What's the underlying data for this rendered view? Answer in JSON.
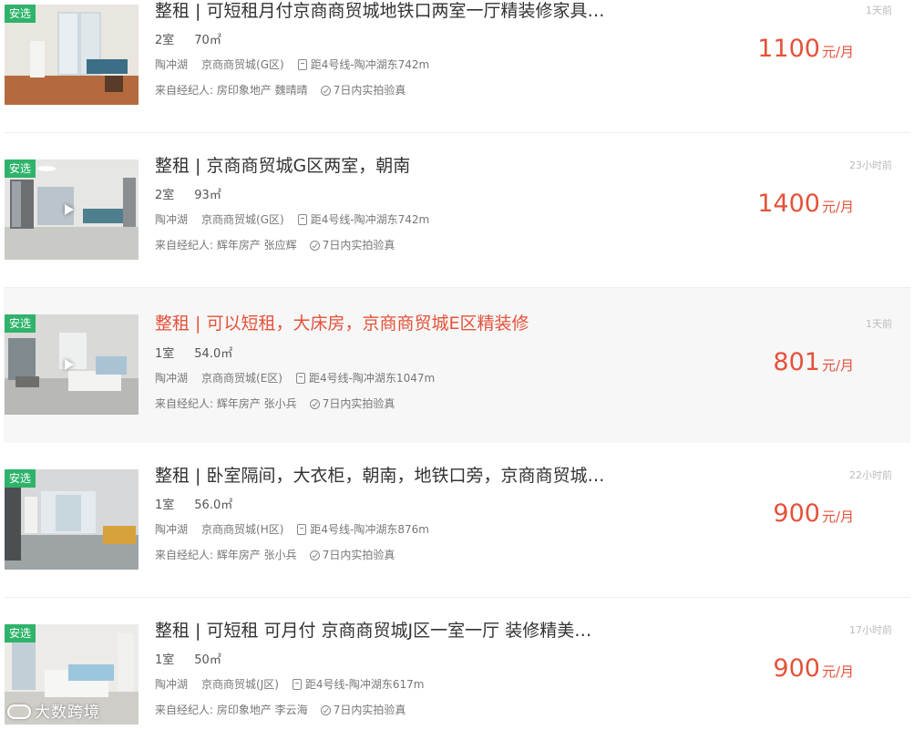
{
  "listings": [
    {
      "badge": "安选",
      "title": "整租 | 可短租月付京商商贸城地铁口两室一厅精装修家具…",
      "rooms": "2室",
      "area": "70㎡",
      "district": "陶冲湖",
      "community": "京商商贸城(G区)",
      "subway": "距4号线-陶冲湖东742m",
      "agent": "来自经纪人: 房印象地产 魏晴晴",
      "verified": "7日内实拍验真",
      "time": "1天前",
      "price": "1100",
      "unit": "元/月",
      "has_video": false,
      "highlighted": false
    },
    {
      "badge": "安选",
      "title": "整租 | 京商商贸城G区两室，朝南",
      "rooms": "2室",
      "area": "93㎡",
      "district": "陶冲湖",
      "community": "京商商贸城(G区)",
      "subway": "距4号线-陶冲湖东742m",
      "agent": "来自经纪人: 辉年房产 张应辉",
      "verified": "7日内实拍验真",
      "time": "23小时前",
      "price": "1400",
      "unit": "元/月",
      "has_video": true,
      "highlighted": false
    },
    {
      "badge": "安选",
      "title": "整租 | 可以短租，大床房，京商商贸城E区精装修",
      "rooms": "1室",
      "area": "54.0㎡",
      "district": "陶冲湖",
      "community": "京商商贸城(E区)",
      "subway": "距4号线-陶冲湖东1047m",
      "agent": "来自经纪人: 辉年房产 张小兵",
      "verified": "7日内实拍验真",
      "time": "1天前",
      "price": "801",
      "unit": "元/月",
      "has_video": true,
      "highlighted": true
    },
    {
      "badge": "安选",
      "title": "整租 | 卧室隔间，大衣柜，朝南，地铁口旁，京商商贸城…",
      "rooms": "1室",
      "area": "56.0㎡",
      "district": "陶冲湖",
      "community": "京商商贸城(H区)",
      "subway": "距4号线-陶冲湖东876m",
      "agent": "来自经纪人: 辉年房产 张小兵",
      "verified": "7日内实拍验真",
      "time": "22小时前",
      "price": "900",
      "unit": "元/月",
      "has_video": false,
      "highlighted": false
    },
    {
      "badge": "安选",
      "title": "整租 | 可短租 可月付 京商商贸城J区一室一厅 装修精美…",
      "rooms": "1室",
      "area": "50㎡",
      "district": "陶冲湖",
      "community": "京商商贸城(J区)",
      "subway": "距4号线-陶冲湖东617m",
      "agent": "来自经纪人: 房印象地产 李云海",
      "verified": "7日内实拍验真",
      "time": "17小时前",
      "price": "900",
      "unit": "元/月",
      "has_video": false,
      "highlighted": false
    }
  ],
  "watermark": "大数跨境",
  "colors": {
    "accent": "#e4523a",
    "badge": "#2fb36b",
    "highlight_bg": "#f7f7f7"
  }
}
